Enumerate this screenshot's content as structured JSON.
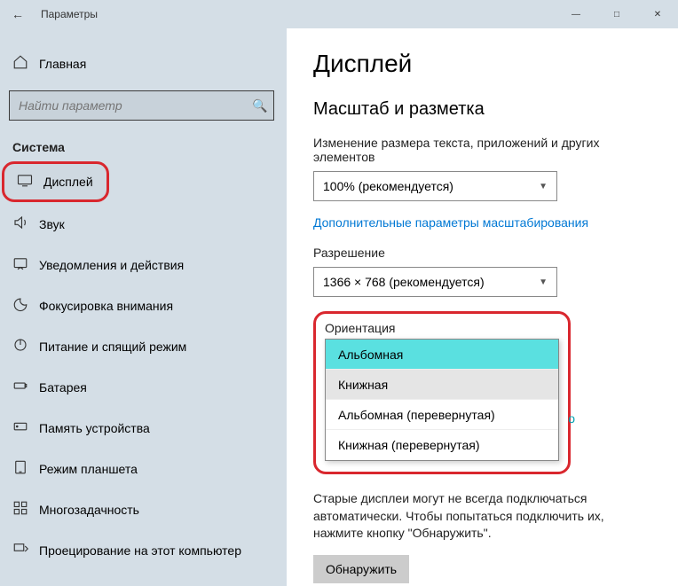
{
  "titlebar": {
    "title": "Параметры"
  },
  "sidebar": {
    "home": "Главная",
    "search_placeholder": "Найти параметр",
    "section": "Система",
    "items": [
      {
        "label": "Дисплей"
      },
      {
        "label": "Звук"
      },
      {
        "label": "Уведомления и действия"
      },
      {
        "label": "Фокусировка внимания"
      },
      {
        "label": "Питание и спящий режим"
      },
      {
        "label": "Батарея"
      },
      {
        "label": "Память устройства"
      },
      {
        "label": "Режим планшета"
      },
      {
        "label": "Многозадачность"
      },
      {
        "label": "Проецирование на этот компьютер"
      }
    ]
  },
  "content": {
    "heading": "Дисплей",
    "scale_section": "Масштаб и разметка",
    "scale_label": "Изменение размера текста, приложений и других элементов",
    "scale_value": "100% (рекомендуется)",
    "advanced_link": "Дополнительные параметры масштабирования",
    "resolution_label": "Разрешение",
    "resolution_value": "1366 × 768 (рекомендуется)",
    "orientation_label": "Ориентация",
    "orientation_options": [
      "Альбомная",
      "Книжная",
      "Альбомная (перевернутая)",
      "Книжная (перевернутая)"
    ],
    "side_letter": "о",
    "detect_note": "Старые дисплеи могут не всегда подключаться автоматически. Чтобы попытаться подключить их, нажмите кнопку \"Обнаружить\".",
    "detect_button": "Обнаружить"
  }
}
